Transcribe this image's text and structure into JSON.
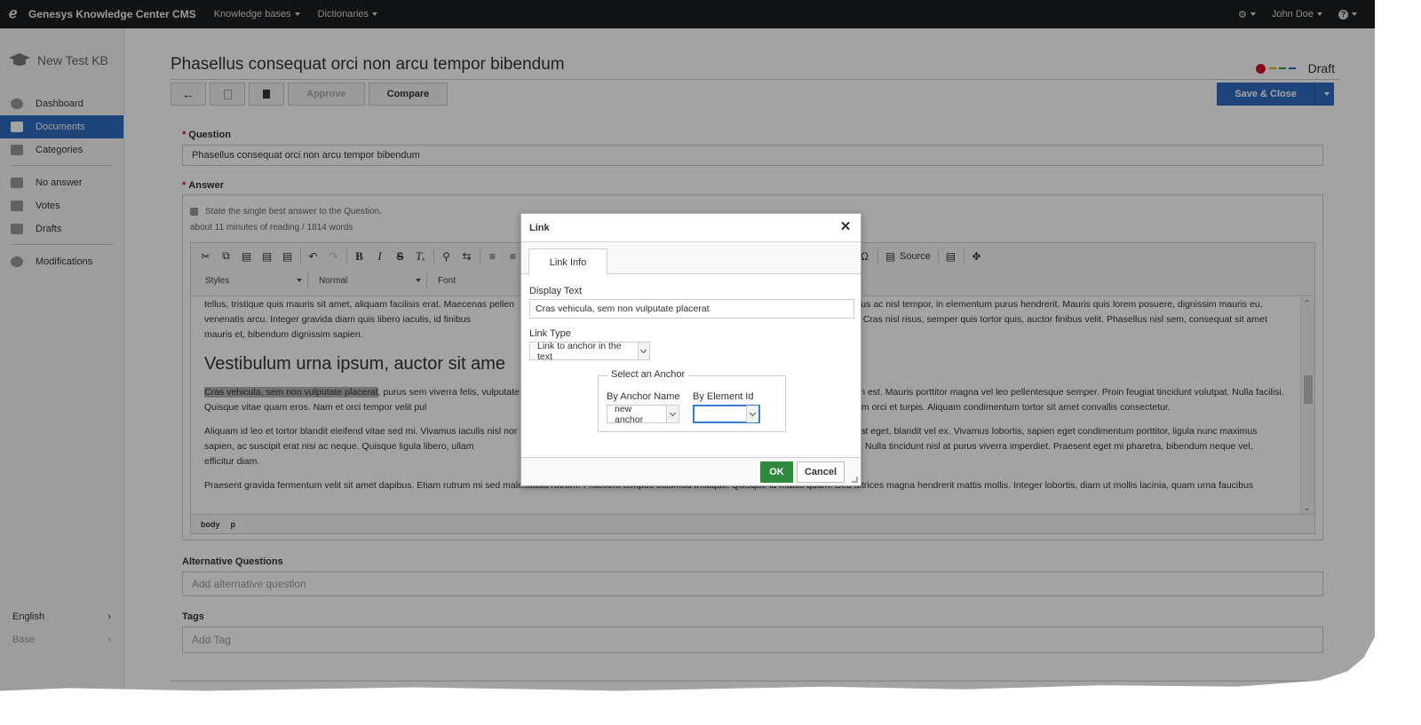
{
  "topbar": {
    "brand": "Genesys Knowledge Center CMS",
    "nav": [
      "Knowledge bases",
      "Dictionaries"
    ],
    "user": "John Doe"
  },
  "sidebar": {
    "kb_name": "New Test KB",
    "items": [
      {
        "label": "Dashboard",
        "icon": "dashboard-icon"
      },
      {
        "label": "Documents",
        "icon": "documents-icon"
      },
      {
        "label": "Categories",
        "icon": "tag-icon"
      },
      {
        "label": "No answer",
        "icon": "no-answer-icon"
      },
      {
        "label": "Votes",
        "icon": "votes-icon"
      },
      {
        "label": "Drafts",
        "icon": "drafts-icon"
      },
      {
        "label": "Modifications",
        "icon": "modifications-icon"
      }
    ],
    "language": "English",
    "base": "Base"
  },
  "doc": {
    "title": "Phasellus consequat orci non arcu tempor bibendum",
    "status": "Draft",
    "status_colors": [
      "#d1142b",
      "#e0b400",
      "#2e9b4a",
      "#2e6bc0"
    ]
  },
  "toolbar": {
    "approve": "Approve",
    "compare": "Compare",
    "save_close": "Save & Close"
  },
  "form": {
    "question_label": "Question",
    "question_value": "Phasellus consequat orci non arcu tempor bibendum",
    "answer_label": "Answer",
    "answer_hint": "State the single best answer to the Question.",
    "word_count": "about 11 minutes of reading / 1814 words",
    "alt_label": "Alternative Questions",
    "alt_placeholder": "Add alternative question",
    "tags_label": "Tags",
    "tags_placeholder": "Add Tag"
  },
  "editor": {
    "source": "Source",
    "styles": "Styles",
    "format": "Normal",
    "font": "Font",
    "para1": "tellus, tristique quis mauris sit amet, aliquam facilisis erat. Maecenas pellen                                                                                                                   ommodo risus ac nisl tempor, in elementum purus hendrerit. Mauris quis lorem posuere, dignissim mauris eu, venenatis arcu. Integer gravida diam quis libero iaculis, id finibus                                                                                                          s nulla, vitae dignissim velit. Cras nisl risus, semper quis tortor quis, auctor finibus velit. Phasellus nisl sem, consequat sit amet mauris et, bibendum dignissim sapien.",
    "heading": "Vestibulum urna ipsum, auctor sit ame",
    "para2_highlight": "Cras vehicula, sem non vulputate placerat",
    "para2_rest": ", purus sem viverra felis, vulputate                                                                                                            nc at sollicitudin est. Mauris porttitor magna vel leo pellentesque semper. Proin feugiat tincidunt volutpat. Nulla facilisi. Quisque vitae quam eros. Nam et orci tempor velit pul                                                                                                      mattis, eros eros porta risus, ut cursus sem orci et turpis. Aliquam condimentum tortor sit amet convallis consectetur.",
    "para3": "Aliquam id leo et tortor blandit eleifend vitae sed mi. Vivamus iaculis nisl nor                                                                                                           culis quis volutpat eget, blandit vel ex. Vivamus lobortis, sapien eget condimentum porttitor, ligula nunc maximus sapien, ac suscipit erat nisi ac neque. Quisque ligula libero, ullam                                                                                                      . Sed laoreet molestie sagittis. Nulla tincidunt nisl at purus viverra imperdiet. Praesent eget mi pharetra, bibendum neque vel, efficitur diam.",
    "para4": "Praesent gravida fermentum velit sit amet dapibus. Etiam rutrum mi sed malesuada rutrum. Praesent tempus euismod tristique. Quisque id mattis quam. Sed ultrices magna hendrerit mattis mollis. Integer lobortis, diam ut mollis lacinia, quam urna faucibus",
    "path": [
      "body",
      "p"
    ]
  },
  "dialog": {
    "title": "Link",
    "tab": "Link Info",
    "display_text_label": "Display Text",
    "display_text_value": "Cras vehicula, sem non vulputate placerat",
    "link_type_label": "Link Type",
    "link_type_value": "Link to anchor in the text",
    "anchor_legend": "Select an Anchor",
    "by_name_label": "By Anchor Name",
    "by_name_value": "new anchor",
    "by_id_label": "By Element Id",
    "by_id_value": "",
    "ok": "OK",
    "cancel": "Cancel"
  }
}
